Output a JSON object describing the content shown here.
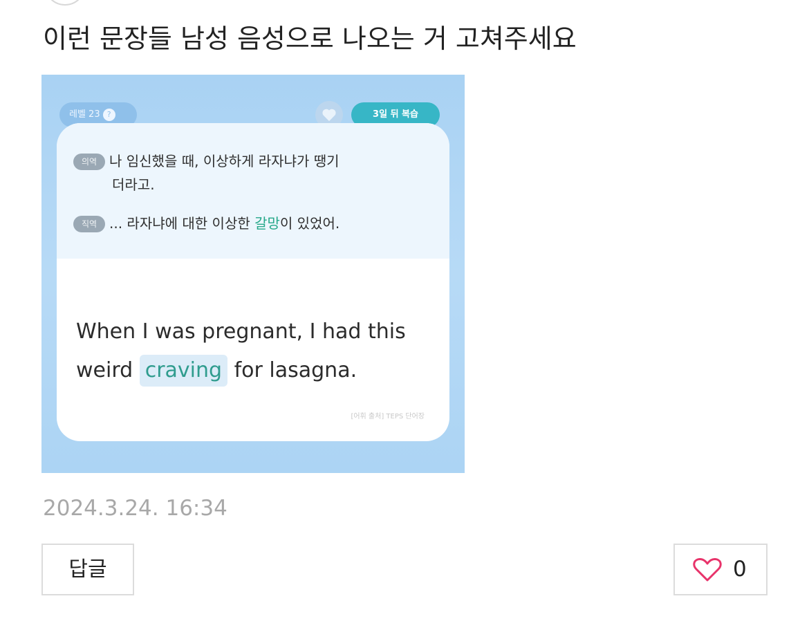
{
  "post": {
    "title": "이런 문장들 남성 음성으로 나오는 거 고쳐주세요",
    "date": "2024.3.24. 16:34"
  },
  "image": {
    "level_chip": "레벨 23",
    "help_icon_glyph": "?",
    "review_chip": "3일 뒤 복습",
    "meaning_tag": "의역",
    "meaning_text_1": "나 임신했을 때, 이상하게 라자냐가 땡기",
    "meaning_text_2": "더라고.",
    "literal_tag": "직역",
    "literal_text_before": "... 라자냐에 대한 이상한 ",
    "literal_highlight": "갈망",
    "literal_text_after": "이 있었어.",
    "english_before": "When I was pregnant, I had this weird ",
    "english_highlight": "craving",
    "english_after": " for lasagna.",
    "source": "[어휘 출처] TEPS 단어장"
  },
  "actions": {
    "reply_label": "답글",
    "like_count": "0"
  },
  "colors": {
    "like_heart": "#e8336a",
    "review_chip": "#37b6c6",
    "highlight_text": "#26a88a",
    "date_text": "#a8a8a8"
  }
}
